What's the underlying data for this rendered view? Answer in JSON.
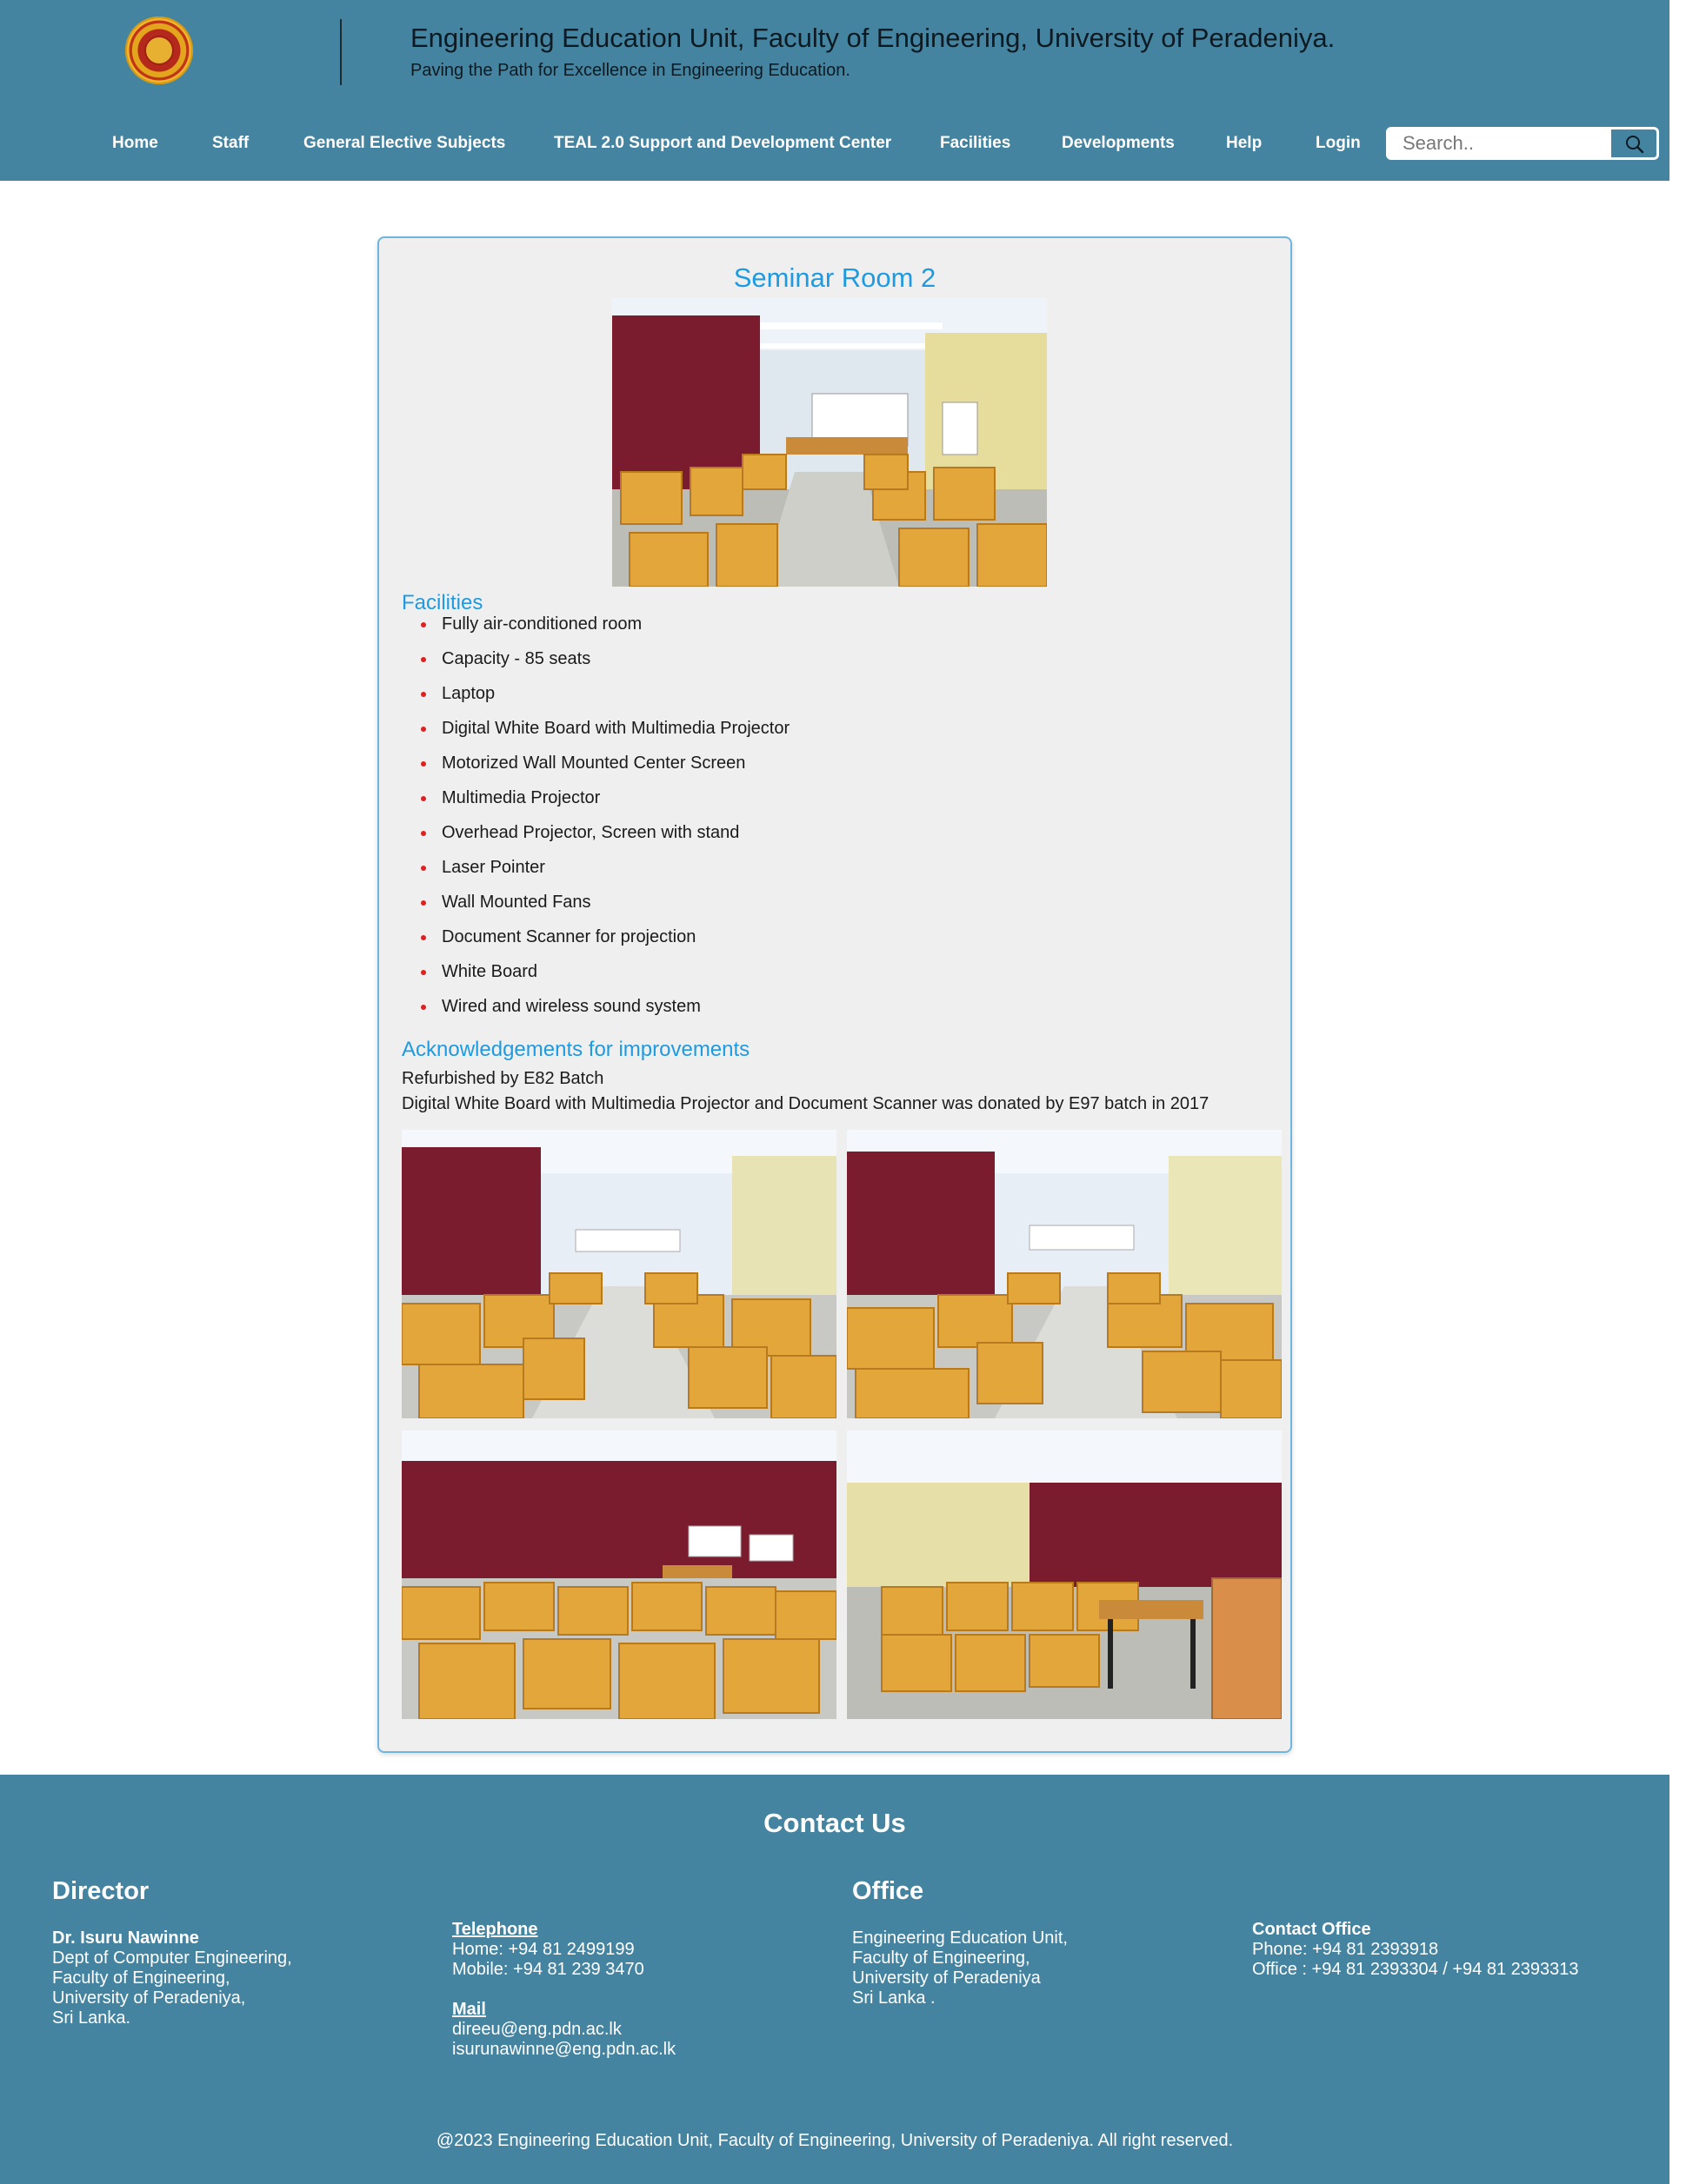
{
  "header": {
    "title": "Engineering Education Unit, Faculty of Engineering, University of Peradeniya.",
    "tagline": "Paving the Path for Excellence in Engineering Education.",
    "brand_color": "#4484a0"
  },
  "nav": {
    "items": [
      {
        "label": "Home"
      },
      {
        "label": "Staff"
      },
      {
        "label": "General Elective Subjects"
      },
      {
        "label": "TEAL 2.0 Support and Development Center"
      },
      {
        "label": "Facilities"
      },
      {
        "label": "Developments"
      },
      {
        "label": "Help"
      },
      {
        "label": "Login"
      }
    ],
    "search": {
      "placeholder": "Search..",
      "icon": "search-icon"
    }
  },
  "room": {
    "title": "Seminar Room 2",
    "facilities_heading": "Facilities",
    "facilities": [
      "Fully air-conditioned room",
      "Capacity - 85 seats",
      "Laptop",
      "Digital White Board with Multimedia Projector",
      "Motorized Wall Mounted Center Screen",
      "Multimedia Projector",
      "Overhead Projector, Screen with stand",
      "Laser Pointer",
      "Wall Mounted Fans",
      "Document Scanner for projection",
      "White Board",
      "Wired and wireless sound system"
    ],
    "ack_heading": "Acknowledgements for improvements",
    "ack_lines": [
      "Refurbished by E82 Batch",
      "Digital White Board with Multimedia Projector and Document Scanner was donated by E97 batch in 2017"
    ],
    "accent_color": "#1e9be0",
    "bullet_color": "#e02020"
  },
  "footer": {
    "title": "Contact Us",
    "director": {
      "heading": "Director",
      "name": "Dr. Isuru Nawinne",
      "lines": [
        "Dept of Computer Engineering,",
        "Faculty of Engineering,",
        "University of Peradeniya,",
        "Sri Lanka."
      ]
    },
    "telephone": {
      "label": "Telephone",
      "home": "Home: +94 81 2499199",
      "mobile": "Mobile: +94 81 239 3470"
    },
    "mail": {
      "label": "Mail",
      "emails": [
        "direeu@eng.pdn.ac.lk",
        "isurunawinne@eng.pdn.ac.lk"
      ]
    },
    "office": {
      "heading": "Office",
      "lines": [
        "Engineering Education Unit,",
        "Faculty of Engineering,",
        "University of Peradeniya",
        "Sri Lanka ."
      ]
    },
    "contact_office": {
      "label": "Contact Office",
      "phone": "Phone: +94 81 2393918",
      "office": "Office : +94 81 2393304 / +94 81 2393313"
    },
    "copyright": "@2023 Engineering Education Unit, Faculty of Engineering, University of Peradeniya. All right reserved."
  }
}
